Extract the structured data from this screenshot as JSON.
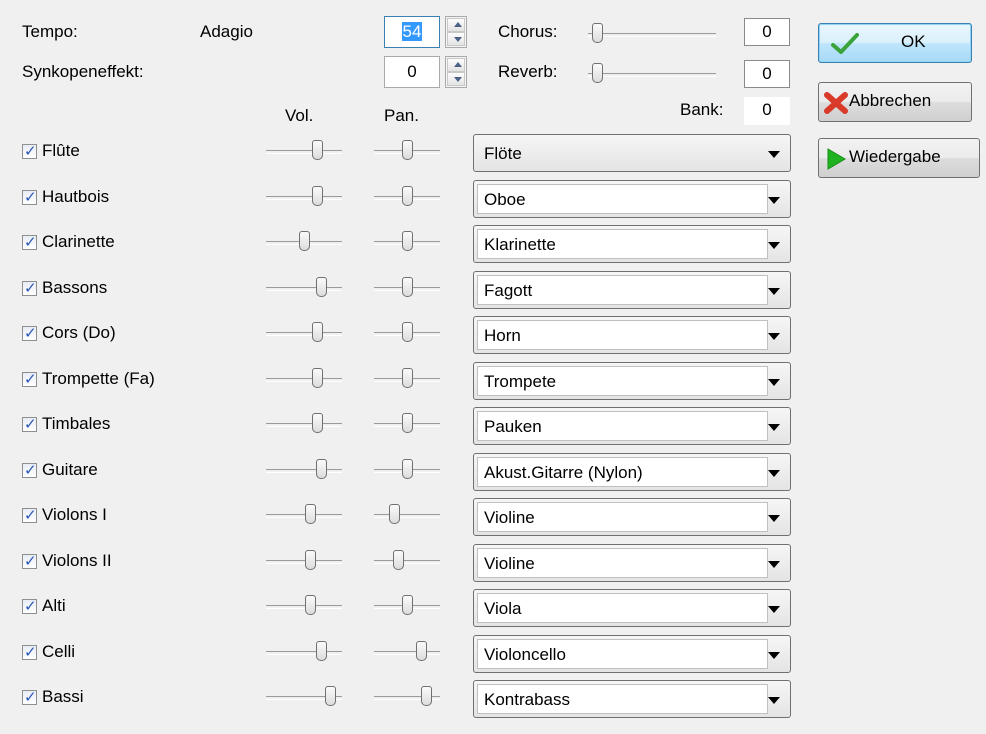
{
  "header": {
    "tempo_label": "Tempo:",
    "tempo_name": "Adagio",
    "tempo_value": "54",
    "syncope_label": "Synkopeneffekt:",
    "syncope_value": "0",
    "chorus_label": "Chorus:",
    "chorus_value": "0",
    "chorus_level": 0,
    "reverb_label": "Reverb:",
    "reverb_value": "0",
    "reverb_level": 0,
    "bank_label": "Bank:",
    "bank_value": "0",
    "vol_header": "Vol.",
    "pan_header": "Pan."
  },
  "buttons": {
    "ok": "OK",
    "cancel": "Abbrechen",
    "play": "Wiedergabe"
  },
  "instruments": [
    {
      "name": "Flûte",
      "checked": true,
      "vol": 0.71,
      "pan": 0.5,
      "sound": "Flöte"
    },
    {
      "name": "Hautbois",
      "checked": true,
      "vol": 0.71,
      "pan": 0.5,
      "sound": "Oboe"
    },
    {
      "name": "Clarinette",
      "checked": true,
      "vol": 0.5,
      "pan": 0.5,
      "sound": "Klarinette"
    },
    {
      "name": "Bassons",
      "checked": true,
      "vol": 0.77,
      "pan": 0.5,
      "sound": "Fagott"
    },
    {
      "name": "Cors (Do)",
      "checked": true,
      "vol": 0.71,
      "pan": 0.5,
      "sound": "Horn"
    },
    {
      "name": "Trompette (Fa)",
      "checked": true,
      "vol": 0.71,
      "pan": 0.5,
      "sound": "Trompete"
    },
    {
      "name": "Timbales",
      "checked": true,
      "vol": 0.71,
      "pan": 0.5,
      "sound": "Pauken"
    },
    {
      "name": "Guitare",
      "checked": true,
      "vol": 0.77,
      "pan": 0.5,
      "sound": "Akust.Gitarre (Nylon)"
    },
    {
      "name": "Violons I",
      "checked": true,
      "vol": 0.6,
      "pan": 0.27,
      "sound": "Violine"
    },
    {
      "name": "Violons II",
      "checked": true,
      "vol": 0.6,
      "pan": 0.35,
      "sound": "Violine"
    },
    {
      "name": "Alti",
      "checked": true,
      "vol": 0.6,
      "pan": 0.5,
      "sound": "Viola"
    },
    {
      "name": "Celli",
      "checked": true,
      "vol": 0.77,
      "pan": 0.77,
      "sound": "Violoncello"
    },
    {
      "name": "Bassi",
      "checked": true,
      "vol": 0.91,
      "pan": 0.85,
      "sound": "Kontrabass"
    }
  ],
  "colors": {
    "background": "#f0f0f0",
    "ok_icon": "#3ca33c",
    "cancel_icon": "#d93a2a",
    "play_icon": "#1fb31f"
  },
  "icons": {
    "ok": "checkmark-icon",
    "cancel": "red-x-icon",
    "play": "play-triangle-icon"
  }
}
